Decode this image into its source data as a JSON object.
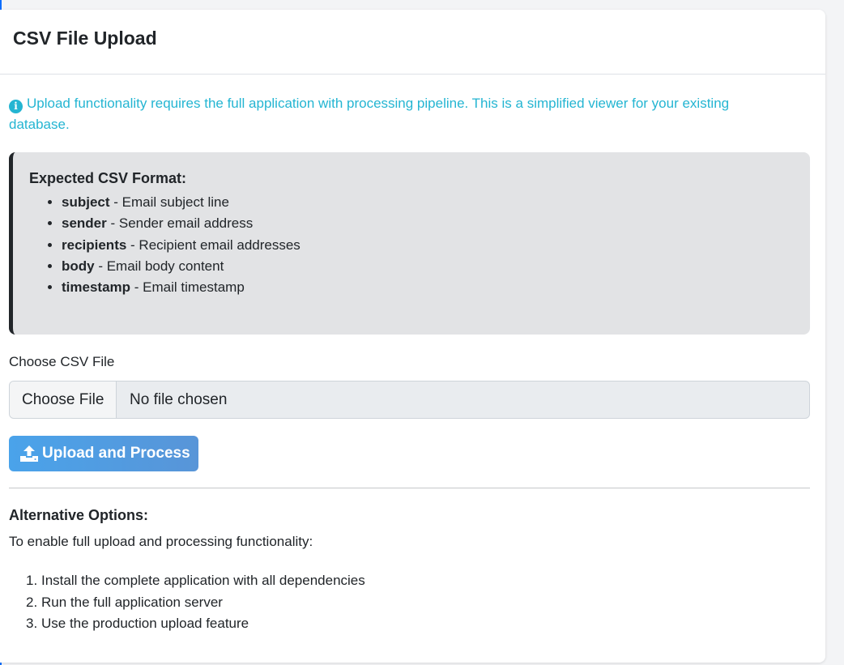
{
  "header": {
    "title": "CSV File Upload"
  },
  "info": {
    "icon": "info-circle-icon",
    "color": "#24b5d2",
    "text": "Upload functionality requires the full application with processing pipeline. This is a simplified viewer for your existing database."
  },
  "format": {
    "title": "Expected CSV Format:",
    "fields": [
      {
        "name": "subject",
        "desc": " - Email subject line"
      },
      {
        "name": "sender",
        "desc": " - Sender email address"
      },
      {
        "name": "recipients",
        "desc": " - Recipient email addresses"
      },
      {
        "name": "body",
        "desc": " - Email body content"
      },
      {
        "name": "timestamp",
        "desc": " - Email timestamp"
      }
    ]
  },
  "upload": {
    "label": "Choose CSV File",
    "choose_button": "Choose File",
    "no_file": "No file chosen",
    "submit_label": "Upload and Process",
    "submit_icon": "upload-icon"
  },
  "alternatives": {
    "title": "Alternative Options:",
    "description": "To enable full upload and processing functionality:",
    "steps": [
      {
        "num": "1.",
        "text": "Install the complete application with all dependencies"
      },
      {
        "num": "2.",
        "text": "Run the full application server"
      },
      {
        "num": "3.",
        "text": "Use the production upload feature"
      }
    ]
  }
}
